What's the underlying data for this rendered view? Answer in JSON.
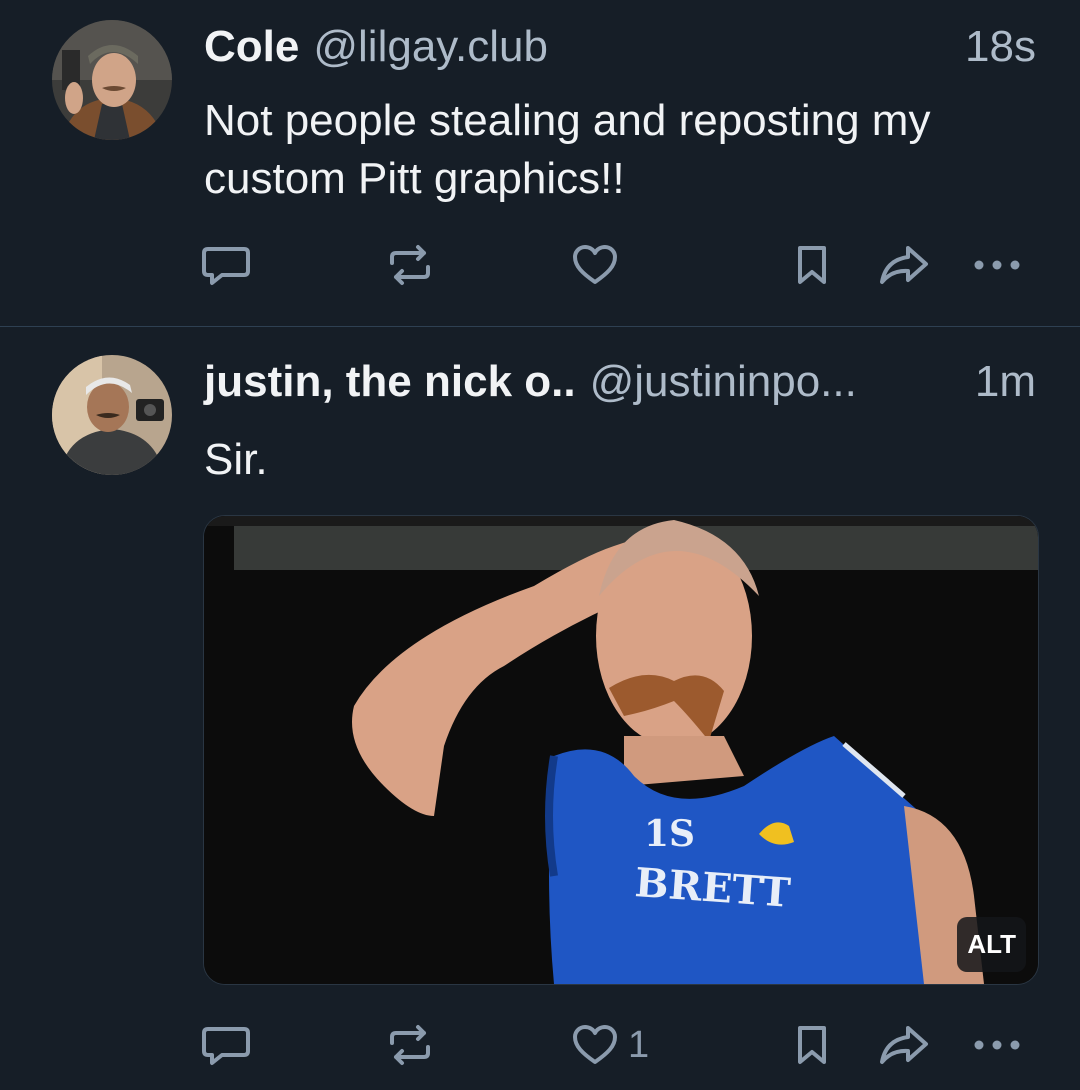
{
  "posts": [
    {
      "author_name": "Cole",
      "handle": "@lilgay.club",
      "time": "18s",
      "text": "Not people stealing and reposting my custom Pitt graphics!!",
      "actions": {
        "reply_icon": "reply-icon",
        "repost_icon": "repost-icon",
        "like_icon": "heart-icon",
        "like_count": "",
        "bookmark_icon": "bookmark-icon",
        "share_icon": "share-icon",
        "more_icon": "more-icon"
      }
    },
    {
      "author_name": "justin, the nick o..",
      "handle": "@justininpo...",
      "time": "1m",
      "text": "Sir.",
      "media": {
        "alt_badge": "ALT"
      },
      "actions": {
        "reply_icon": "reply-icon",
        "repost_icon": "repost-icon",
        "like_icon": "heart-icon",
        "like_count": "1",
        "bookmark_icon": "bookmark-icon",
        "share_icon": "share-icon",
        "more_icon": "more-icon"
      }
    }
  ],
  "colors": {
    "background": "#161e27",
    "divider": "#2e4052",
    "primary_text": "#f1f3f5",
    "secondary_text": "#aebbc9",
    "icon": "#8b9bad"
  }
}
